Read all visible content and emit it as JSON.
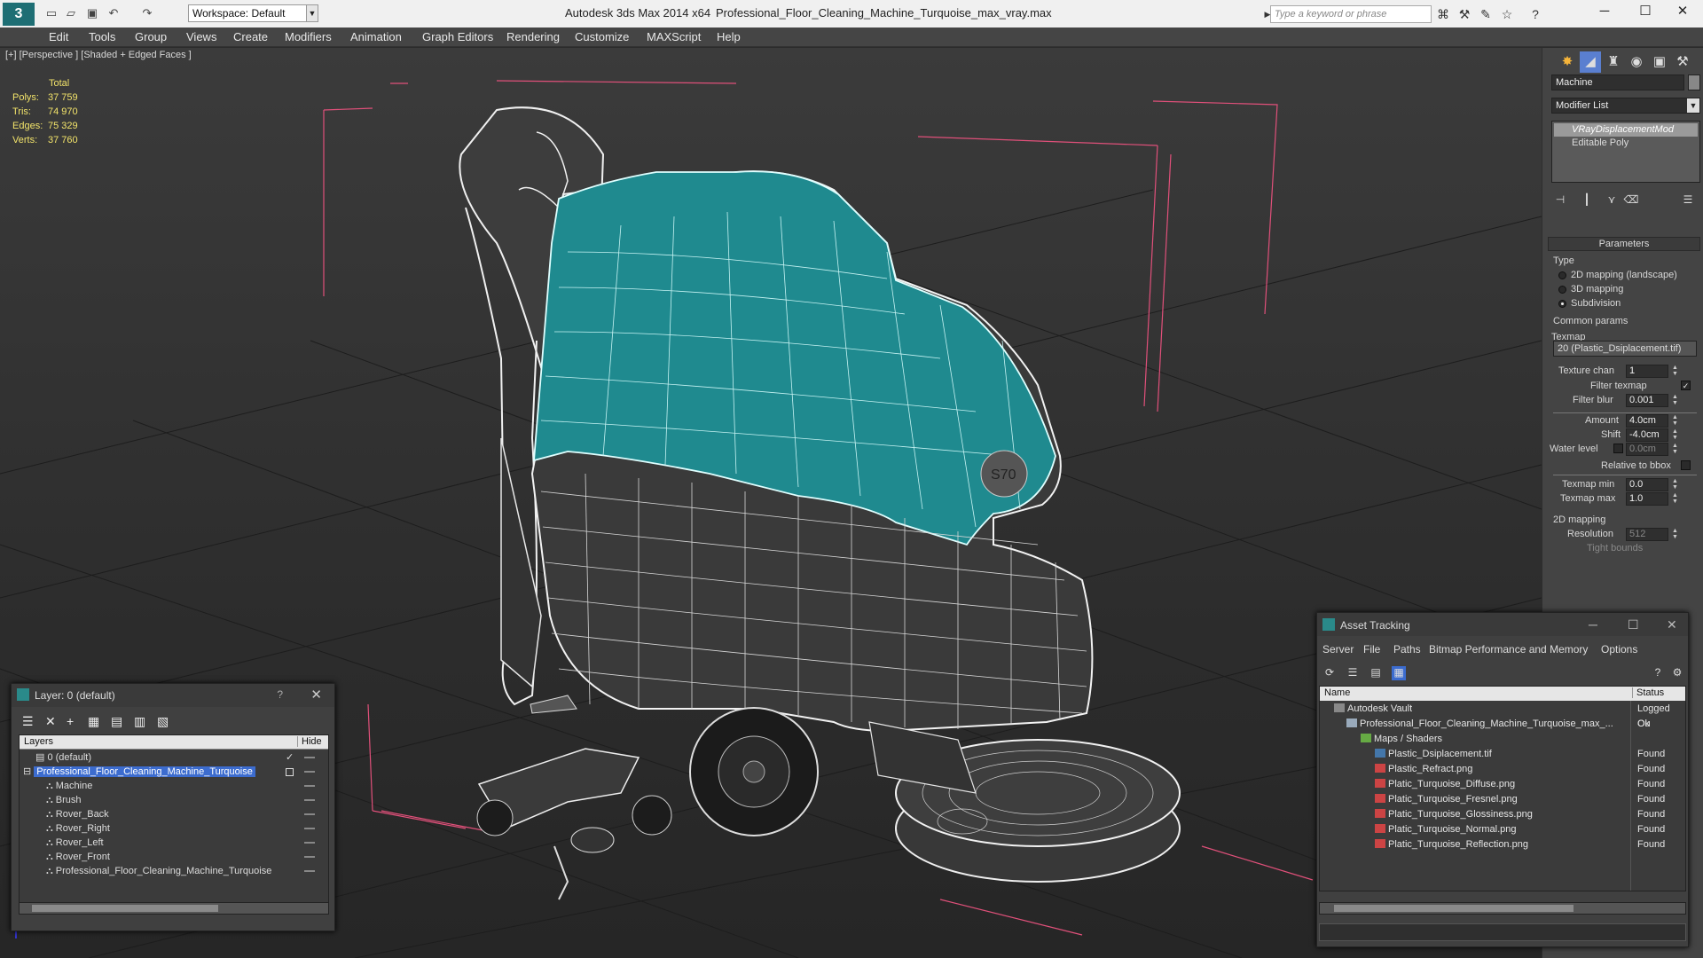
{
  "titlebar": {
    "workspace": "Workspace: Default",
    "app_title": "Autodesk 3ds Max  2014 x64",
    "file_title": "Professional_Floor_Cleaning_Machine_Turquoise_max_vray.max",
    "search_placeholder": "Type a keyword or phrase",
    "minimize": "─",
    "maximize": "☐",
    "close": "✕"
  },
  "menu": [
    "Edit",
    "Tools",
    "Group",
    "Views",
    "Create",
    "Modifiers",
    "Animation",
    "Graph Editors",
    "Rendering",
    "Customize",
    "MAXScript",
    "Help"
  ],
  "viewport": {
    "label": "[+] [Perspective ] [Shaded + Edged Faces ]",
    "stats": {
      "header": "Total",
      "rows": [
        {
          "k": "Polys:",
          "v": "37 759"
        },
        {
          "k": "Tris:",
          "v": "74 970"
        },
        {
          "k": "Edges:",
          "v": "75 329"
        },
        {
          "k": "Verts:",
          "v": "37 760"
        }
      ]
    },
    "logo_text": "S70"
  },
  "command_panel": {
    "object_name": "Machine",
    "modifier_list": "Modifier List",
    "stack": [
      "VRayDisplacementMod",
      "Editable Poly"
    ],
    "rollout": "Parameters",
    "type_label": "Type",
    "type_options": [
      "2D mapping (landscape)",
      "3D mapping",
      "Subdivision"
    ],
    "type_selected": 2,
    "common_params": "Common params",
    "texmap_label": "Texmap",
    "texmap_value": "20 (Plastic_Dsiplacement.tif)",
    "texture_chan_label": "Texture chan",
    "texture_chan": "1",
    "filter_texmap": "Filter texmap",
    "filter_blur_label": "Filter blur",
    "filter_blur": "0.001",
    "amount_label": "Amount",
    "amount": "4.0cm",
    "shift_label": "Shift",
    "shift": "-4.0cm",
    "water_label": "Water level",
    "water": "0.0cm",
    "relative_bbox": "Relative to bbox",
    "texmap_min_label": "Texmap min",
    "texmap_min": "0.0",
    "texmap_max_label": "Texmap max",
    "texmap_max": "1.0",
    "mapping2d": "2D mapping",
    "resolution_label": "Resolution",
    "resolution": "512",
    "tight_bounds": "Tight bounds"
  },
  "layer_window": {
    "title": "Layer: 0 (default)",
    "help": "?",
    "col_layers": "Layers",
    "col_hide": "Hide",
    "rows": [
      {
        "name": "0 (default)",
        "indent": 0
      },
      {
        "name": "Professional_Floor_Cleaning_Machine_Turquoise",
        "indent": 0
      },
      {
        "name": "Machine",
        "indent": 1
      },
      {
        "name": "Brush",
        "indent": 1
      },
      {
        "name": "Rover_Back",
        "indent": 1
      },
      {
        "name": "Rover_Right",
        "indent": 1
      },
      {
        "name": "Rover_Left",
        "indent": 1
      },
      {
        "name": "Rover_Front",
        "indent": 1
      },
      {
        "name": "Professional_Floor_Cleaning_Machine_Turquoise",
        "indent": 1
      }
    ]
  },
  "asset_window": {
    "title": "Asset Tracking",
    "menu": [
      "Server",
      "File",
      "Paths",
      "Bitmap Performance and Memory",
      "Options"
    ],
    "col_name": "Name",
    "col_status": "Status",
    "rows": [
      {
        "name": "Autodesk Vault",
        "status": "Logged Ou",
        "indent": 0
      },
      {
        "name": "Professional_Floor_Cleaning_Machine_Turquoise_max_...",
        "status": "Ok",
        "indent": 1
      },
      {
        "name": "Maps / Shaders",
        "status": "",
        "indent": 2
      },
      {
        "name": "Plastic_Dsiplacement.tif",
        "status": "Found",
        "indent": 3
      },
      {
        "name": "Plastic_Refract.png",
        "status": "Found",
        "indent": 3
      },
      {
        "name": "Platic_Turquoise_Diffuse.png",
        "status": "Found",
        "indent": 3
      },
      {
        "name": "Platic_Turquoise_Fresnel.png",
        "status": "Found",
        "indent": 3
      },
      {
        "name": "Platic_Turquoise_Glossiness.png",
        "status": "Found",
        "indent": 3
      },
      {
        "name": "Platic_Turquoise_Normal.png",
        "status": "Found",
        "indent": 3
      },
      {
        "name": "Platic_Turquoise_Reflection.png",
        "status": "Found",
        "indent": 3
      }
    ]
  },
  "colors": {
    "accent": "#3c6ccf",
    "turquoise": "#1f8a8f",
    "stats": "#f2e36a",
    "bbox": "#e0507a"
  }
}
